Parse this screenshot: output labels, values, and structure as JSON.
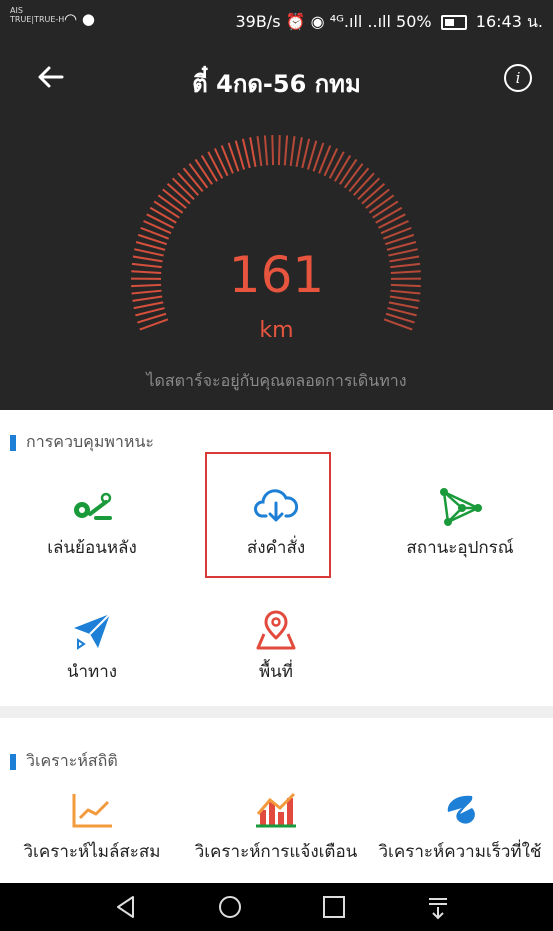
{
  "status": {
    "carrier_line1": "AIS",
    "carrier_line2": "TRUE|TRUE-H",
    "speed": "39B/s",
    "signal": "⁴ᴳ.ıll ..ıll",
    "battery": "50%",
    "time": "16:43 น."
  },
  "header": {
    "title": "ตี๋ 4กด-56 กทม",
    "back_icon": "arrow-left-icon",
    "info_icon": "info-icon",
    "speed_value": "161",
    "speed_unit": "km",
    "tagline": "ไดสตาร์จะอยู่กับคุณตลอดการเดินทาง",
    "gauge_color": "#e8553f"
  },
  "control_section": {
    "title": "การควบคุมพาหนะ",
    "items": [
      {
        "label": "เล่นย้อนหลัง",
        "icon": "playback-route-icon"
      },
      {
        "label": "ส่งคำสั่ง",
        "icon": "cloud-download-icon"
      },
      {
        "label": "สถานะอุปกรณ์",
        "icon": "network-status-icon"
      },
      {
        "label": "นำทาง",
        "icon": "paper-plane-icon"
      },
      {
        "label": "พื้นที่",
        "icon": "location-pin-icon"
      }
    ]
  },
  "stats_section": {
    "title": "วิเคราะห์สถิติ",
    "items": [
      {
        "label": "วิเคราะห์ไมล์สะสม",
        "icon": "line-chart-icon"
      },
      {
        "label": "วิเคราะห์การแจ้งเตือน",
        "icon": "bar-chart-icon"
      },
      {
        "label": "วิเคราะห์ความเร็วที่ใช้",
        "icon": "speed-swirl-icon"
      }
    ]
  },
  "colors": {
    "accent_blue": "#1e7fd6",
    "accent_green": "#1a9a3a",
    "accent_red": "#e14a3c",
    "accent_orange": "#f39a3d",
    "highlight_border": "#d83a3a"
  }
}
